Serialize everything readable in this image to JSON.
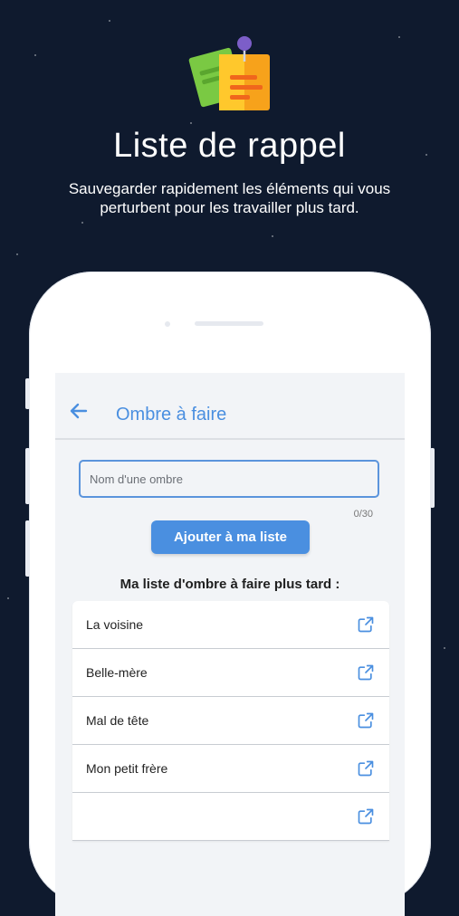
{
  "promo": {
    "title": "Liste de rappel",
    "subtitle_line1": "Sauvegarder rapidement les éléments qui vous",
    "subtitle_line2": "perturbent pour les travailler plus tard."
  },
  "appbar": {
    "back_icon": "arrow-left-icon",
    "title": "Ombre à faire"
  },
  "form": {
    "input_placeholder": "Nom d'une ombre",
    "input_value": "",
    "counter": "0/30",
    "add_button_label": "Ajouter à ma liste"
  },
  "list": {
    "title": "Ma liste d'ombre à faire plus tard :",
    "items": [
      {
        "label": "La voisine",
        "icon": "open-in-new-icon"
      },
      {
        "label": "Belle-mère",
        "icon": "open-in-new-icon"
      },
      {
        "label": "Mal de tête",
        "icon": "open-in-new-icon"
      },
      {
        "label": "Mon petit frère",
        "icon": "open-in-new-icon"
      },
      {
        "label": "",
        "icon": "open-in-new-icon"
      }
    ]
  },
  "colors": {
    "background": "#0f1a2e",
    "accent": "#4a8fe0",
    "screen": "#f2f4f7"
  }
}
